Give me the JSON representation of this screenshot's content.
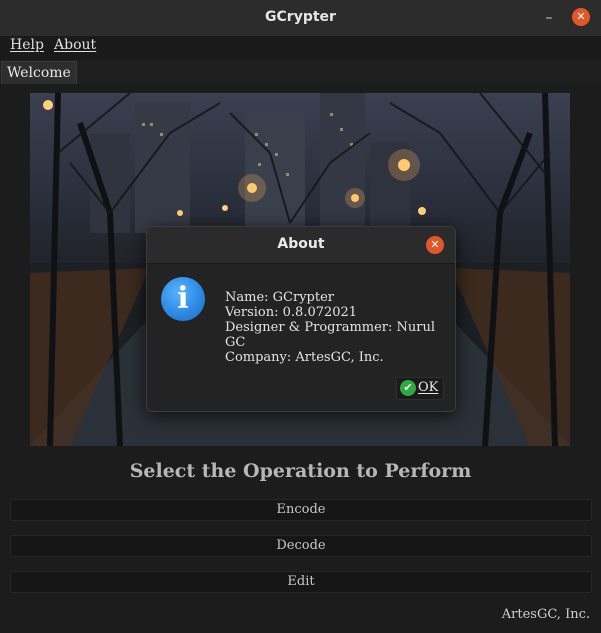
{
  "window": {
    "title": "GCrypter",
    "minimize_glyph": "–",
    "close_glyph": "✕"
  },
  "menu": {
    "items": [
      {
        "label": "Help"
      },
      {
        "label": "About"
      }
    ]
  },
  "tabs": [
    {
      "label": "Welcome"
    }
  ],
  "main": {
    "heading": "Select the Operation to Perform",
    "buttons": [
      {
        "label": "Encode"
      },
      {
        "label": "Decode"
      },
      {
        "label": "Edit"
      }
    ],
    "footer": "ArtesGC, Inc."
  },
  "dialog": {
    "title": "About",
    "close_glyph": "✕",
    "icon": "info-icon",
    "icon_glyph": "i",
    "lines": [
      "Name: GCrypter",
      "Version: 0.8.072021",
      "Designer & Programmer: Nurul GC",
      "Company: ArtesGC, Inc."
    ],
    "ok_label": "OK",
    "ok_icon_glyph": "✔"
  },
  "colors": {
    "close_button": "#e2562a",
    "info_icon": "#2a86e0",
    "ok_check": "#2eaa3e"
  }
}
